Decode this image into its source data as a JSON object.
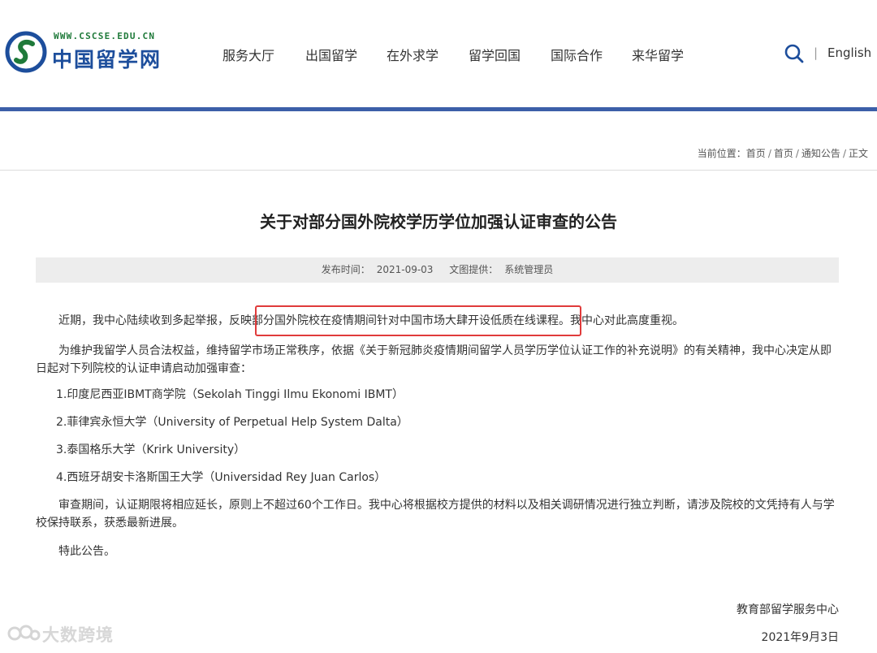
{
  "logo": {
    "url_text": "WWW.CSCSE.EDU.CN",
    "name": "中国留学网",
    "brand_color": "#1d4e9c",
    "accent_green": "#1f7a3a"
  },
  "nav": {
    "items": [
      "服务大厅",
      "出国留学",
      "在外求学",
      "留学回国",
      "国际合作",
      "来华留学"
    ],
    "separator": "|",
    "language": "English"
  },
  "breadcrumb": {
    "prefix": "当前位置：",
    "items": [
      "首页",
      "首页",
      "通知公告",
      "正文"
    ],
    "divider": "/"
  },
  "article": {
    "title": "关于对部分国外院校学历学位加强认证审查的公告",
    "publish_label": "发布时间：",
    "publish_date": "2021-09-03",
    "source_label": "文图提供：",
    "source": "系统管理员",
    "para1_before": "近期，我中心陆续收到多起举报，反映",
    "para1_highlight": "部分国外院校在疫情期间针对中国市场大肆开设低质在线课程。",
    "para1_after": "我中心对此高度重视。",
    "para2": "为维护我留学人员合法权益，维持留学市场正常秩序，依据《关于新冠肺炎疫情期间留学人员学历学位认证工作的补充说明》的有关精神，我中心决定从即日起对下列院校的认证申请启动加强审查：",
    "list": [
      "1.印度尼西亚IBMT商学院（Sekolah Tinggi Ilmu Ekonomi IBMT）",
      "2.菲律宾永恒大学（University of Perpetual Help System Dalta）",
      "3.泰国格乐大学（Krirk University）",
      "4.西班牙胡安卡洛斯国王大学（Universidad Rey Juan Carlos）"
    ],
    "para3": "审查期间，认证期限将相应延长，原则上不超过60个工作日。我中心将根据校方提供的材料以及相关调研情况进行独立判断，请涉及院校的文凭持有人与学校保持联系，获悉最新进展。",
    "para4": "特此公告。",
    "signature": "教育部留学服务中心",
    "date": "2021年9月3日"
  },
  "watermark": {
    "text": "大数跨境"
  },
  "colors": {
    "header_bar": "#3c5fa8",
    "highlight_box": "#e03b3b",
    "meta_bg": "#ededed"
  }
}
